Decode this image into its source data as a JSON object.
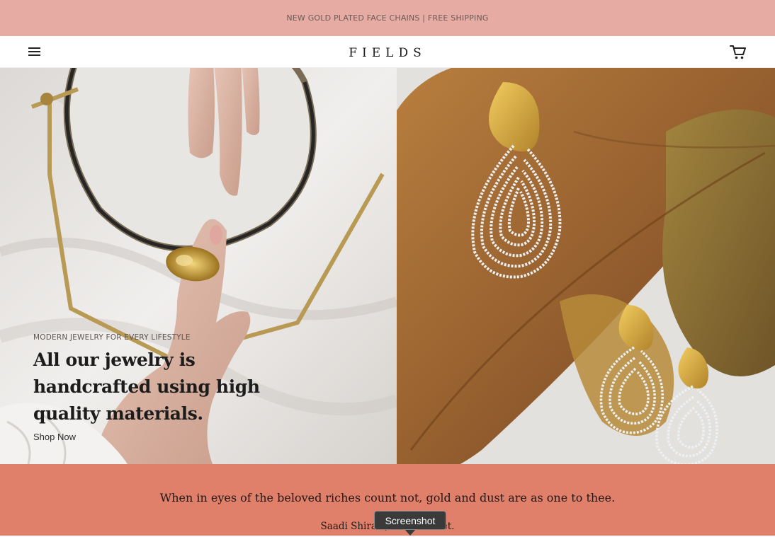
{
  "announcement": {
    "text": "NEW GOLD PLATED FACE CHAINS | FREE SHIPPING"
  },
  "header": {
    "logo": "FIELDS",
    "menu_icon": "hamburger-menu-icon",
    "cart_icon": "shopping-cart-icon"
  },
  "hero": {
    "eyebrow": "MODERN JEWELRY FOR EVERY LIFESTYLE",
    "headline": "All our jewelry is handcrafted using high quality materials.",
    "cta": "Shop Now"
  },
  "quote": {
    "text": "When in eyes of the beloved riches count not, gold and dust are as one to thee.",
    "author": "Saadi Shirazi, Persian Poet."
  },
  "tooltip": {
    "label": "Screenshot"
  },
  "colors": {
    "announcement_bg": "#e6aba2",
    "quote_bg": "#e07f6a",
    "text_dark": "#1c1c1c"
  }
}
